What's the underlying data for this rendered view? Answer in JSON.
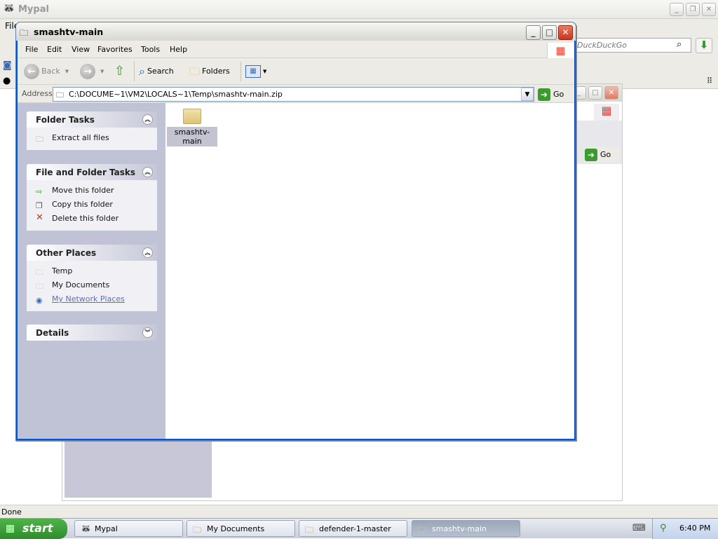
{
  "background_browser": {
    "title": "Mypal",
    "menu_first": "File",
    "search_placeholder": "DuckDuckGo",
    "status": "Done"
  },
  "explorer": {
    "title": "smashtv-main",
    "menu": [
      "File",
      "Edit",
      "View",
      "Favorites",
      "Tools",
      "Help"
    ],
    "toolbar": {
      "back": "Back",
      "search": "Search",
      "folders": "Folders"
    },
    "address_label": "Address",
    "address_value": "C:\\DOCUME~1\\VM2\\LOCALS~1\\Temp\\smashtv-main.zip",
    "go_label": "Go",
    "behind_go_label": "Go",
    "folder_tasks": {
      "title": "Folder Tasks",
      "items": [
        "Extract all files"
      ]
    },
    "file_folder_tasks": {
      "title": "File and Folder Tasks",
      "items": [
        "Move this folder",
        "Copy this folder",
        "Delete this folder"
      ]
    },
    "other_places": {
      "title": "Other Places",
      "items": [
        "Temp",
        "My Documents",
        "My Network Places"
      ]
    },
    "details": {
      "title": "Details"
    },
    "files": [
      {
        "name": "smashtv-main",
        "selected": true
      }
    ]
  },
  "taskbar": {
    "start": "start",
    "tasks": [
      {
        "label": "Mypal",
        "icon": "raccoon-icon",
        "active": false
      },
      {
        "label": "My Documents",
        "icon": "folder-icon",
        "active": false
      },
      {
        "label": "defender-1-master",
        "icon": "folder-icon",
        "active": false
      },
      {
        "label": "smashtv-main",
        "icon": "zip-folder-icon",
        "active": true
      }
    ],
    "clock": "6:40 PM"
  }
}
